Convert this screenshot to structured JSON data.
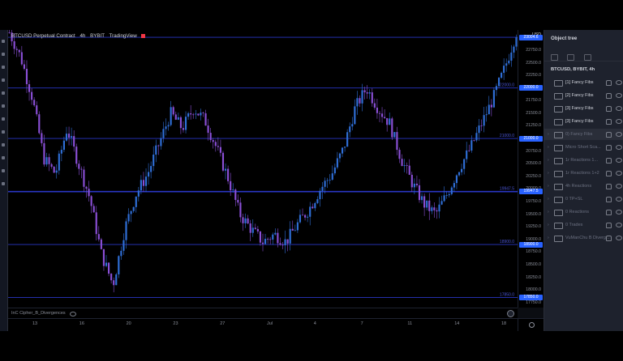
{
  "chart_header": {
    "symbol": "BTCUSD Perpetual Contract",
    "interval": "4h",
    "exchange": "BYBIT",
    "source": "TradingView"
  },
  "indicator_label": "InC Cipher_B_Divergences",
  "price_axis": {
    "currency": "USD",
    "labels": [
      "22750.0",
      "22500.0",
      "22250.0",
      "22000.0",
      "21750.0",
      "21500.0",
      "21250.0",
      "21000.0",
      "20750.0",
      "20500.0",
      "20250.0",
      "20000.0",
      "19750.0",
      "19500.0",
      "19250.0",
      "19000.0",
      "18750.0",
      "18500.0",
      "18250.0",
      "18000.0",
      "17750.0"
    ],
    "tags": [
      {
        "text": "23004.6",
        "color": "#2962ff"
      },
      {
        "text": "22000.0",
        "color": "#2962ff"
      },
      {
        "text": "21000.0",
        "color": "#2962ff"
      },
      {
        "text": "19947.5",
        "color": "#2962ff"
      },
      {
        "text": "18900.0",
        "color": "#2962ff"
      },
      {
        "text": "17850.0",
        "color": "#2962ff"
      }
    ]
  },
  "time_axis": {
    "labels": [
      "13",
      "16",
      "20",
      "23",
      "27",
      "Jul",
      "4",
      "7",
      "11",
      "14",
      "18"
    ]
  },
  "chart_data": {
    "type": "candlestick",
    "interval": "4h",
    "ylim": [
      17650,
      23150
    ],
    "horizontal_lines": [
      23004.6,
      22000,
      21000,
      19947.5,
      18900,
      17850
    ],
    "line_labels": [
      "22000.0",
      "21000.0",
      "19947.5",
      "18900.0",
      "17850.0"
    ],
    "x_labels": [
      "13",
      "16",
      "20",
      "23",
      "27",
      "Jul",
      "4",
      "7",
      "11",
      "14",
      "18"
    ],
    "price_path": [
      23100,
      22600,
      21800,
      20600,
      20300,
      21200,
      20500,
      19800,
      18700,
      18100,
      19200,
      19900,
      20300,
      20900,
      21500,
      21200,
      21600,
      21350,
      20800,
      20200,
      19500,
      19200,
      18950,
      19100,
      18950,
      19300,
      19600,
      20000,
      20300,
      20800,
      21600,
      22000,
      21600,
      21300,
      20600,
      20100,
      19700,
      19500,
      19900,
      20400,
      20800,
      21300,
      21800,
      22400,
      23100
    ]
  },
  "object_tree": {
    "title": "Object tree",
    "header": "BTCUSD, BYBIT, 4h",
    "items": [
      {
        "label": "[1] Fancy Fibs",
        "dim": false
      },
      {
        "label": "[2] Fancy Fibs",
        "dim": false
      },
      {
        "label": "[3] Fancy Fibs",
        "dim": false
      },
      {
        "label": "[3] Fancy Fibs",
        "dim": false
      },
      {
        "label": "0) Fancy Fibs",
        "dim": true
      },
      {
        "label": "Micro Short Sca...",
        "dim": true
      },
      {
        "label": "1r Reactions 1...",
        "dim": true
      },
      {
        "label": "1r Reactions 1+2",
        "dim": true
      },
      {
        "label": "4h Reactions",
        "dim": true
      },
      {
        "label": "0 TP+SL",
        "dim": true
      },
      {
        "label": "0 Reactions",
        "dim": true
      },
      {
        "label": "0 Trades",
        "dim": true
      },
      {
        "label": "VuManChu B Diverg...",
        "dim": true
      }
    ]
  }
}
